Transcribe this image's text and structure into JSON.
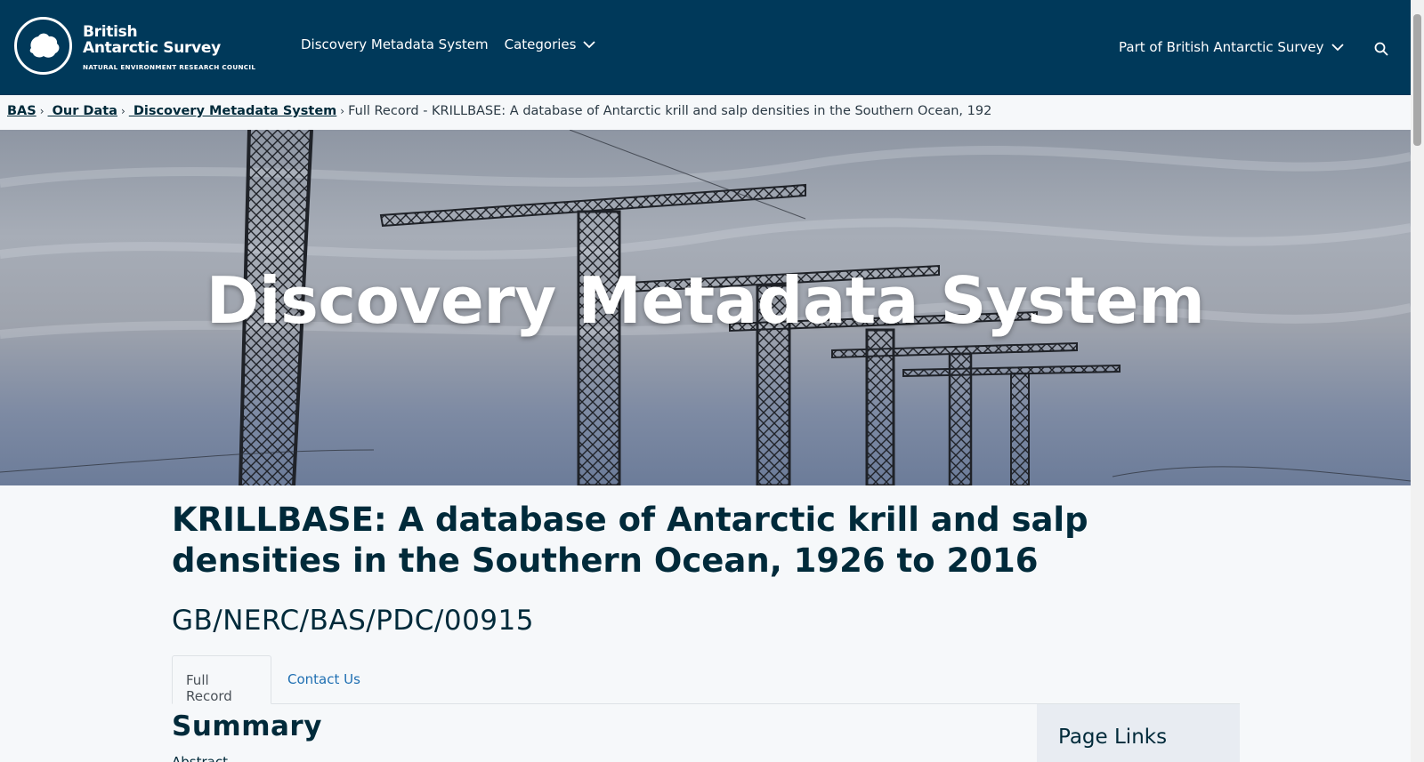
{
  "header": {
    "logo_line1": "British",
    "logo_line2": "Antarctic Survey",
    "logo_line3": "NATURAL ENVIRONMENT RESEARCH COUNCIL",
    "nav": [
      {
        "label": "Discovery Metadata System"
      },
      {
        "label": "Categories"
      }
    ],
    "part_of": "Part of British Antarctic Survey",
    "icons": {
      "search": "search-icon",
      "chevron": "chevron-down-icon",
      "logo": "antarctica-logo-icon"
    }
  },
  "breadcrumb": {
    "items": [
      "BAS",
      " Our Data",
      " Discovery Metadata System"
    ],
    "current": "Full Record - KRILLBASE: A database of Antarctic krill and salp densities in the Southern Ocean, 192"
  },
  "hero": {
    "title": "Discovery Metadata System"
  },
  "record": {
    "title": "KRILLBASE: A database of Antarctic krill and salp densities in the Southern Ocean, 1926 to 2016",
    "id": "GB/NERC/BAS/PDC/00915"
  },
  "tabs": [
    {
      "label": "Full Record",
      "active": true
    },
    {
      "label": "Contact Us",
      "active": false
    }
  ],
  "summary": {
    "heading": "Summary",
    "abstract_label": "Abstract"
  },
  "sidebar": {
    "title": "Page Links"
  },
  "colors": {
    "header_bg": "#00395a",
    "text_dark": "#002a3a",
    "link_blue": "#1f6fb2"
  }
}
